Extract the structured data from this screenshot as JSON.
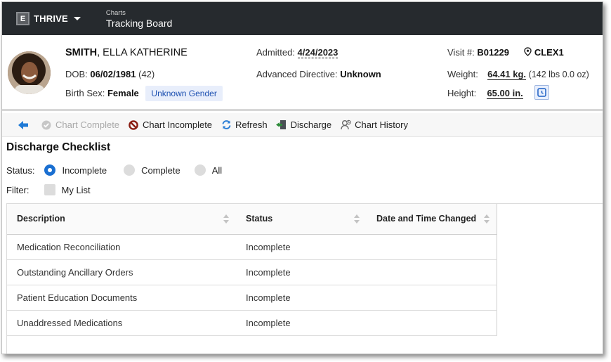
{
  "topbar": {
    "logo_letter": "E",
    "app_name": "THRIVE",
    "breadcrumb_small": "Charts",
    "breadcrumb_title": "Tracking Board"
  },
  "patient": {
    "last_name": "SMITH",
    "first_names": "ELLA KATHERINE",
    "dob_label": "DOB:",
    "dob": "06/02/1981",
    "age": "(42)",
    "birth_sex_label": "Birth Sex:",
    "birth_sex": "Female",
    "gender_badge": "Unknown Gender",
    "admitted_label": "Admitted:",
    "admitted": "4/24/2023",
    "directive_label": "Advanced Directive:",
    "directive": "Unknown",
    "visit_label": "Visit #:",
    "visit": "B01229",
    "location": "CLEX1",
    "weight_label": "Weight:",
    "weight": "64.41 kg.",
    "weight_alt": "(142 lbs 0.0 oz)",
    "height_label": "Height:",
    "height": "65.00 in."
  },
  "toolbar": {
    "chart_complete": "Chart Complete",
    "chart_incomplete": "Chart Incomplete",
    "refresh": "Refresh",
    "discharge": "Discharge",
    "chart_history": "Chart History"
  },
  "checklist": {
    "title": "Discharge Checklist",
    "status_label": "Status:",
    "status_options": [
      "Incomplete",
      "Complete",
      "All"
    ],
    "status_selected": "Incomplete",
    "filter_label": "Filter:",
    "filter_option": "My List",
    "columns": [
      "Description",
      "Status",
      "Date and Time Changed"
    ],
    "rows": [
      {
        "description": "Medication Reconciliation",
        "status": "Incomplete",
        "changed": ""
      },
      {
        "description": "Outstanding Ancillary Orders",
        "status": "Incomplete",
        "changed": ""
      },
      {
        "description": "Patient Education Documents",
        "status": "Incomplete",
        "changed": ""
      },
      {
        "description": "Unaddressed Medications",
        "status": "Incomplete",
        "changed": ""
      }
    ]
  },
  "colors": {
    "topbar": "#262a2e",
    "accent": "#1a6fd1",
    "badge_bg": "#e8eefb",
    "badge_text": "#1b4fb0"
  }
}
